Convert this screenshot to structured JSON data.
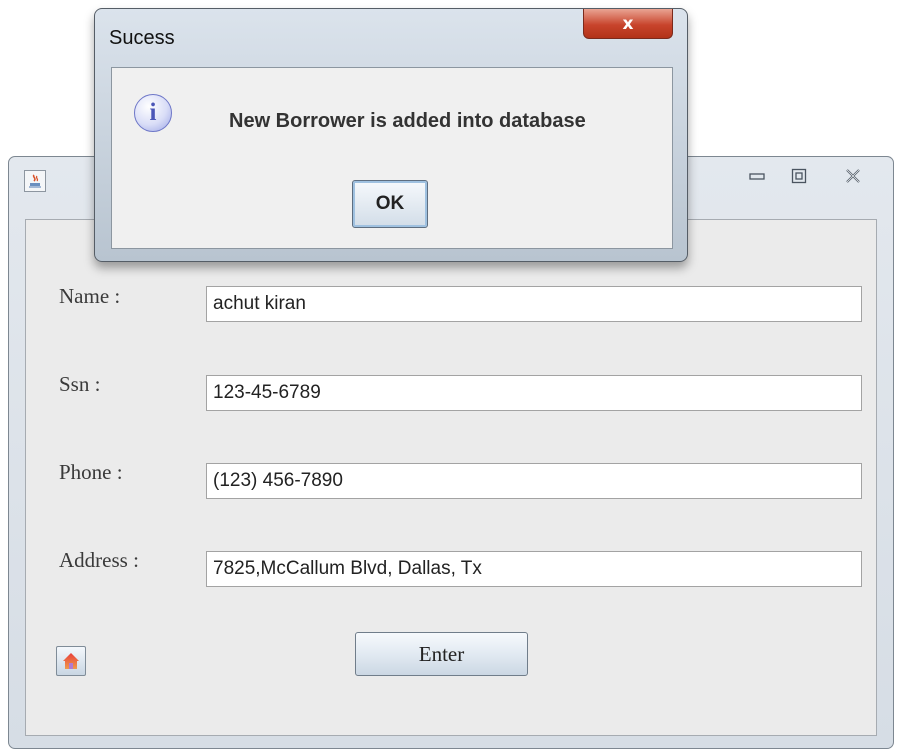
{
  "dialog": {
    "title": "Sucess",
    "close_label": "x",
    "message": "New Borrower is added into database",
    "ok_label": "OK",
    "icon": "info-icon"
  },
  "window": {
    "icon": "java-app-icon",
    "controls": {
      "minimize": "minimize-icon",
      "maximize": "maximize-icon",
      "close": "close-icon"
    }
  },
  "form": {
    "fields": [
      {
        "label": "Name :",
        "value": "achut kiran"
      },
      {
        "label": "Ssn :",
        "value": "123-45-6789"
      },
      {
        "label": "Phone :",
        "value": "(123) 456-7890"
      },
      {
        "label": "Address :",
        "value": "7825,McCallum Blvd, Dallas, Tx"
      }
    ],
    "enter_label": "Enter",
    "home_icon": "home-icon"
  },
  "colors": {
    "dialog_close": "#c8442c",
    "info_icon": "#6e77c8"
  }
}
